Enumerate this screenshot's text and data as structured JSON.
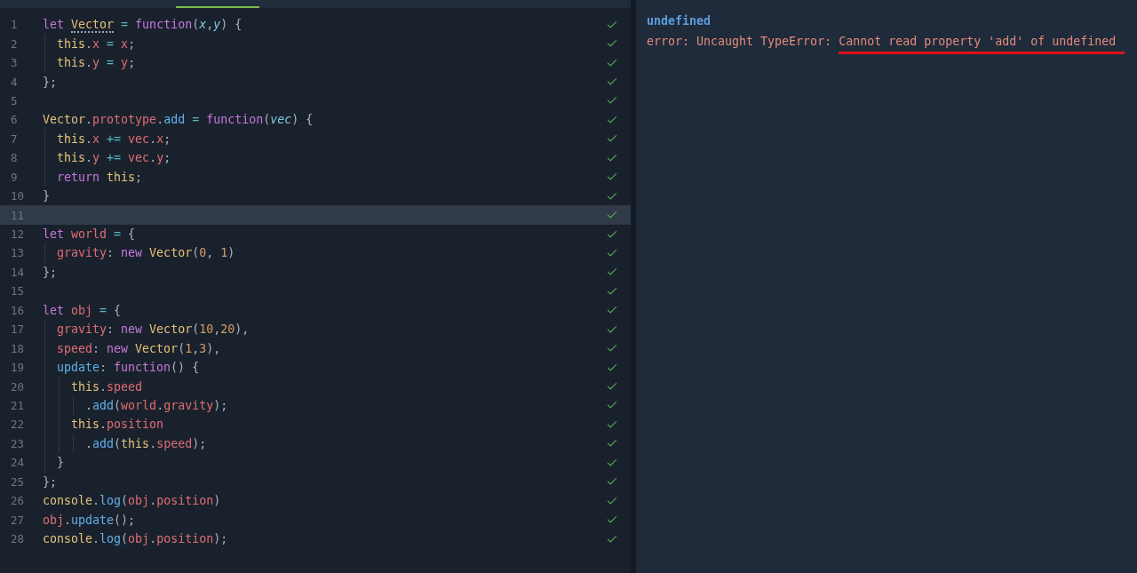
{
  "editor": {
    "lines": [
      {
        "number": "1",
        "checked": true,
        "current": false,
        "tokens": [
          {
            "kind": "kw",
            "text": "let "
          },
          {
            "kind": "type",
            "text": "Vector",
            "hinted": true
          },
          {
            "kind": "op",
            "text": " = "
          },
          {
            "kind": "kw",
            "text": "function"
          },
          {
            "kind": "punct",
            "text": "("
          },
          {
            "kind": "param",
            "text": "x"
          },
          {
            "kind": "punct",
            "text": ","
          },
          {
            "kind": "param",
            "text": "y"
          },
          {
            "kind": "punct",
            "text": ") {"
          }
        ]
      },
      {
        "number": "2",
        "checked": true,
        "current": false,
        "tokens": [
          {
            "kind": "this",
            "text": "  this"
          },
          {
            "kind": "punct",
            "text": "."
          },
          {
            "kind": "prop",
            "text": "x"
          },
          {
            "kind": "op",
            "text": " = "
          },
          {
            "kind": "prop",
            "text": "x"
          },
          {
            "kind": "punct",
            "text": ";"
          }
        ]
      },
      {
        "number": "3",
        "checked": true,
        "current": false,
        "tokens": [
          {
            "kind": "this",
            "text": "  this"
          },
          {
            "kind": "punct",
            "text": "."
          },
          {
            "kind": "prop",
            "text": "y"
          },
          {
            "kind": "op",
            "text": " = "
          },
          {
            "kind": "prop",
            "text": "y"
          },
          {
            "kind": "punct",
            "text": ";"
          }
        ]
      },
      {
        "number": "4",
        "checked": true,
        "current": false,
        "tokens": [
          {
            "kind": "punct",
            "text": "};"
          }
        ]
      },
      {
        "number": "5",
        "checked": true,
        "current": false
      },
      {
        "number": "6",
        "checked": true,
        "current": false,
        "tokens": [
          {
            "kind": "type",
            "text": "Vector"
          },
          {
            "kind": "punct",
            "text": "."
          },
          {
            "kind": "prop",
            "text": "prototype"
          },
          {
            "kind": "punct",
            "text": "."
          },
          {
            "kind": "method",
            "text": "add"
          },
          {
            "kind": "op",
            "text": " = "
          },
          {
            "kind": "kw",
            "text": "function"
          },
          {
            "kind": "punct",
            "text": "("
          },
          {
            "kind": "param",
            "text": "vec"
          },
          {
            "kind": "punct",
            "text": ") {"
          }
        ]
      },
      {
        "number": "7",
        "checked": true,
        "current": false,
        "tokens": [
          {
            "kind": "this",
            "text": "  this"
          },
          {
            "kind": "punct",
            "text": "."
          },
          {
            "kind": "prop",
            "text": "x"
          },
          {
            "kind": "op",
            "text": " += "
          },
          {
            "kind": "prop",
            "text": "vec"
          },
          {
            "kind": "punct",
            "text": "."
          },
          {
            "kind": "prop",
            "text": "x"
          },
          {
            "kind": "punct",
            "text": ";"
          }
        ]
      },
      {
        "number": "8",
        "checked": true,
        "current": false,
        "tokens": [
          {
            "kind": "this",
            "text": "  this"
          },
          {
            "kind": "punct",
            "text": "."
          },
          {
            "kind": "prop",
            "text": "y"
          },
          {
            "kind": "op",
            "text": " += "
          },
          {
            "kind": "prop",
            "text": "vec"
          },
          {
            "kind": "punct",
            "text": "."
          },
          {
            "kind": "prop",
            "text": "y"
          },
          {
            "kind": "punct",
            "text": ";"
          }
        ]
      },
      {
        "number": "9",
        "checked": true,
        "current": false,
        "tokens": [
          {
            "kind": "kw",
            "text": "  return "
          },
          {
            "kind": "this",
            "text": "this"
          },
          {
            "kind": "punct",
            "text": ";"
          }
        ]
      },
      {
        "number": "10",
        "checked": true,
        "current": false,
        "tokens": [
          {
            "kind": "punct",
            "text": "}"
          }
        ]
      },
      {
        "number": "11",
        "checked": true,
        "current": true
      },
      {
        "number": "12",
        "checked": true,
        "current": false,
        "tokens": [
          {
            "kind": "kw",
            "text": "let "
          },
          {
            "kind": "prop",
            "text": "world"
          },
          {
            "kind": "op",
            "text": " = "
          },
          {
            "kind": "punct",
            "text": "{"
          }
        ]
      },
      {
        "number": "13",
        "checked": true,
        "current": false,
        "tokens": [
          {
            "kind": "prop",
            "text": "  gravity"
          },
          {
            "kind": "punct",
            "text": ": "
          },
          {
            "kind": "kw",
            "text": "new "
          },
          {
            "kind": "type",
            "text": "Vector"
          },
          {
            "kind": "punct",
            "text": "("
          },
          {
            "kind": "num",
            "text": "0"
          },
          {
            "kind": "punct",
            "text": ", "
          },
          {
            "kind": "num",
            "text": "1"
          },
          {
            "kind": "punct",
            "text": ")"
          }
        ]
      },
      {
        "number": "14",
        "checked": true,
        "current": false,
        "tokens": [
          {
            "kind": "punct",
            "text": "};"
          }
        ]
      },
      {
        "number": "15",
        "checked": true,
        "current": false
      },
      {
        "number": "16",
        "checked": true,
        "current": false,
        "tokens": [
          {
            "kind": "kw",
            "text": "let "
          },
          {
            "kind": "prop",
            "text": "obj"
          },
          {
            "kind": "op",
            "text": " = "
          },
          {
            "kind": "punct",
            "text": "{"
          }
        ]
      },
      {
        "number": "17",
        "checked": true,
        "current": false,
        "tokens": [
          {
            "kind": "prop",
            "text": "  gravity"
          },
          {
            "kind": "punct",
            "text": ": "
          },
          {
            "kind": "kw",
            "text": "new "
          },
          {
            "kind": "type",
            "text": "Vector"
          },
          {
            "kind": "punct",
            "text": "("
          },
          {
            "kind": "num",
            "text": "10"
          },
          {
            "kind": "punct",
            "text": ","
          },
          {
            "kind": "num",
            "text": "20"
          },
          {
            "kind": "punct",
            "text": "),"
          }
        ]
      },
      {
        "number": "18",
        "checked": true,
        "current": false,
        "tokens": [
          {
            "kind": "prop",
            "text": "  speed"
          },
          {
            "kind": "punct",
            "text": ": "
          },
          {
            "kind": "kw",
            "text": "new "
          },
          {
            "kind": "type",
            "text": "Vector"
          },
          {
            "kind": "punct",
            "text": "("
          },
          {
            "kind": "num",
            "text": "1"
          },
          {
            "kind": "punct",
            "text": ","
          },
          {
            "kind": "num",
            "text": "3"
          },
          {
            "kind": "punct",
            "text": "),"
          }
        ]
      },
      {
        "number": "19",
        "checked": true,
        "current": false,
        "tokens": [
          {
            "kind": "method",
            "text": "  update"
          },
          {
            "kind": "punct",
            "text": ": "
          },
          {
            "kind": "kw",
            "text": "function"
          },
          {
            "kind": "punct",
            "text": "() {"
          }
        ]
      },
      {
        "number": "20",
        "checked": true,
        "current": false,
        "tokens": [
          {
            "kind": "this",
            "text": "    this"
          },
          {
            "kind": "punct",
            "text": "."
          },
          {
            "kind": "prop",
            "text": "speed"
          }
        ]
      },
      {
        "number": "21",
        "checked": true,
        "current": false,
        "tokens": [
          {
            "kind": "punct",
            "text": "      ."
          },
          {
            "kind": "method",
            "text": "add"
          },
          {
            "kind": "punct",
            "text": "("
          },
          {
            "kind": "prop",
            "text": "world"
          },
          {
            "kind": "punct",
            "text": "."
          },
          {
            "kind": "prop",
            "text": "gravity"
          },
          {
            "kind": "punct",
            "text": ");"
          }
        ]
      },
      {
        "number": "22",
        "checked": true,
        "current": false,
        "tokens": [
          {
            "kind": "this",
            "text": "    this"
          },
          {
            "kind": "punct",
            "text": "."
          },
          {
            "kind": "prop",
            "text": "position"
          }
        ]
      },
      {
        "number": "23",
        "checked": true,
        "current": false,
        "tokens": [
          {
            "kind": "punct",
            "text": "      ."
          },
          {
            "kind": "method",
            "text": "add"
          },
          {
            "kind": "punct",
            "text": "("
          },
          {
            "kind": "this",
            "text": "this"
          },
          {
            "kind": "punct",
            "text": "."
          },
          {
            "kind": "prop",
            "text": "speed"
          },
          {
            "kind": "punct",
            "text": ");"
          }
        ]
      },
      {
        "number": "24",
        "checked": true,
        "current": false,
        "tokens": [
          {
            "kind": "punct",
            "text": "  }"
          }
        ]
      },
      {
        "number": "25",
        "checked": true,
        "current": false,
        "tokens": [
          {
            "kind": "punct",
            "text": "};"
          }
        ]
      },
      {
        "number": "26",
        "checked": true,
        "current": false,
        "tokens": [
          {
            "kind": "type",
            "text": "console"
          },
          {
            "kind": "punct",
            "text": "."
          },
          {
            "kind": "method",
            "text": "log"
          },
          {
            "kind": "punct",
            "text": "("
          },
          {
            "kind": "prop",
            "text": "obj"
          },
          {
            "kind": "punct",
            "text": "."
          },
          {
            "kind": "prop",
            "text": "position"
          },
          {
            "kind": "punct",
            "text": ")"
          }
        ]
      },
      {
        "number": "27",
        "checked": true,
        "current": false,
        "tokens": [
          {
            "kind": "prop",
            "text": "obj"
          },
          {
            "kind": "punct",
            "text": "."
          },
          {
            "kind": "method",
            "text": "update"
          },
          {
            "kind": "punct",
            "text": "();"
          }
        ]
      },
      {
        "number": "28",
        "checked": true,
        "current": false,
        "tokens": [
          {
            "kind": "type",
            "text": "console"
          },
          {
            "kind": "punct",
            "text": "."
          },
          {
            "kind": "method",
            "text": "log"
          },
          {
            "kind": "punct",
            "text": "("
          },
          {
            "kind": "prop",
            "text": "obj"
          },
          {
            "kind": "punct",
            "text": "."
          },
          {
            "kind": "prop",
            "text": "position"
          },
          {
            "kind": "punct",
            "text": ");"
          }
        ]
      }
    ]
  },
  "console": {
    "entries": [
      {
        "kind": "value",
        "parts": [
          {
            "text": "undefined",
            "underlined": false
          }
        ]
      },
      {
        "kind": "error",
        "parts": [
          {
            "text": "error: Uncaught TypeError: ",
            "underlined": false
          },
          {
            "text": "Cannot read property 'add' of undefined",
            "underlined": true
          }
        ]
      }
    ]
  }
}
